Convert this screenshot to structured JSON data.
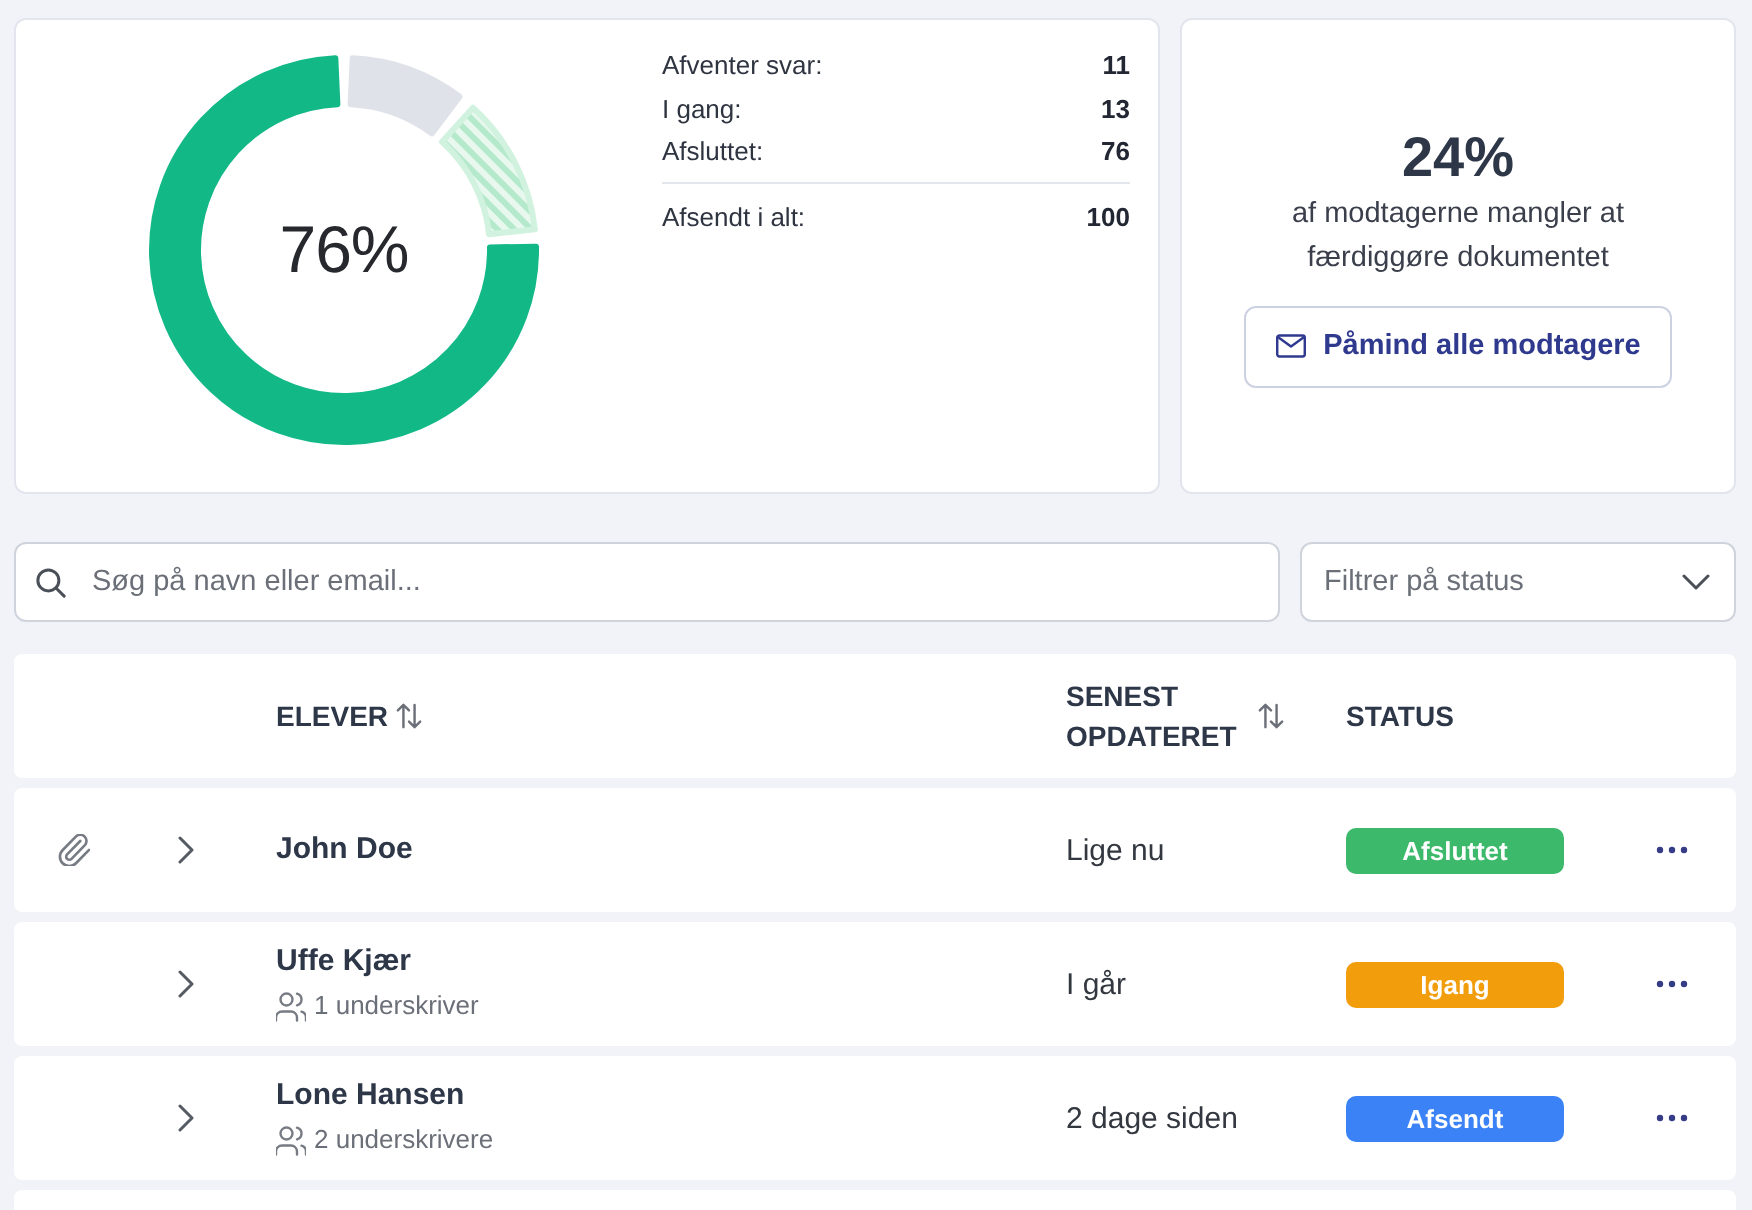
{
  "overview": {
    "chart_data": {
      "type": "donut",
      "values": [
        11,
        13,
        76
      ]
    },
    "center_label": "76%",
    "stats": [
      {
        "label": "Afventer svar:",
        "value": "11"
      },
      {
        "label": "I gang:",
        "value": "13"
      },
      {
        "label": "Afsluttet:",
        "value": "76"
      }
    ],
    "total": {
      "label": "Afsendt i alt:",
      "value": "100"
    }
  },
  "reminder": {
    "percent": "24%",
    "text": "af modtagerne mangler at færdiggøre dokumentet",
    "button": "Påmind alle modtagere"
  },
  "search": {
    "placeholder": "Søg på navn eller email..."
  },
  "status_filter": {
    "placeholder": "Filtrer på status"
  },
  "table": {
    "columns": [
      {
        "label": "ELEVER",
        "sortable": true
      },
      {
        "label": "SENEST OPDATERET",
        "sortable": true
      },
      {
        "label": "STATUS",
        "sortable": false
      }
    ],
    "rows": [
      {
        "attachment": true,
        "expanded": false,
        "name": "John Doe",
        "updated": "Lige nu",
        "status": {
          "label": "Afsluttet",
          "color": "#3cb96a"
        }
      },
      {
        "attachment": false,
        "expanded": false,
        "name": "Uffe Kjær",
        "signers": "1 underskriver",
        "updated": "I går",
        "status": {
          "label": "Igang",
          "color": "#f29d0b"
        }
      },
      {
        "attachment": false,
        "expanded": false,
        "name": "Lone Hansen",
        "signers": "2 underskrivere",
        "updated": "2 dage siden",
        "status": {
          "label": "Afsendt",
          "color": "#3b82f6"
        }
      }
    ]
  }
}
